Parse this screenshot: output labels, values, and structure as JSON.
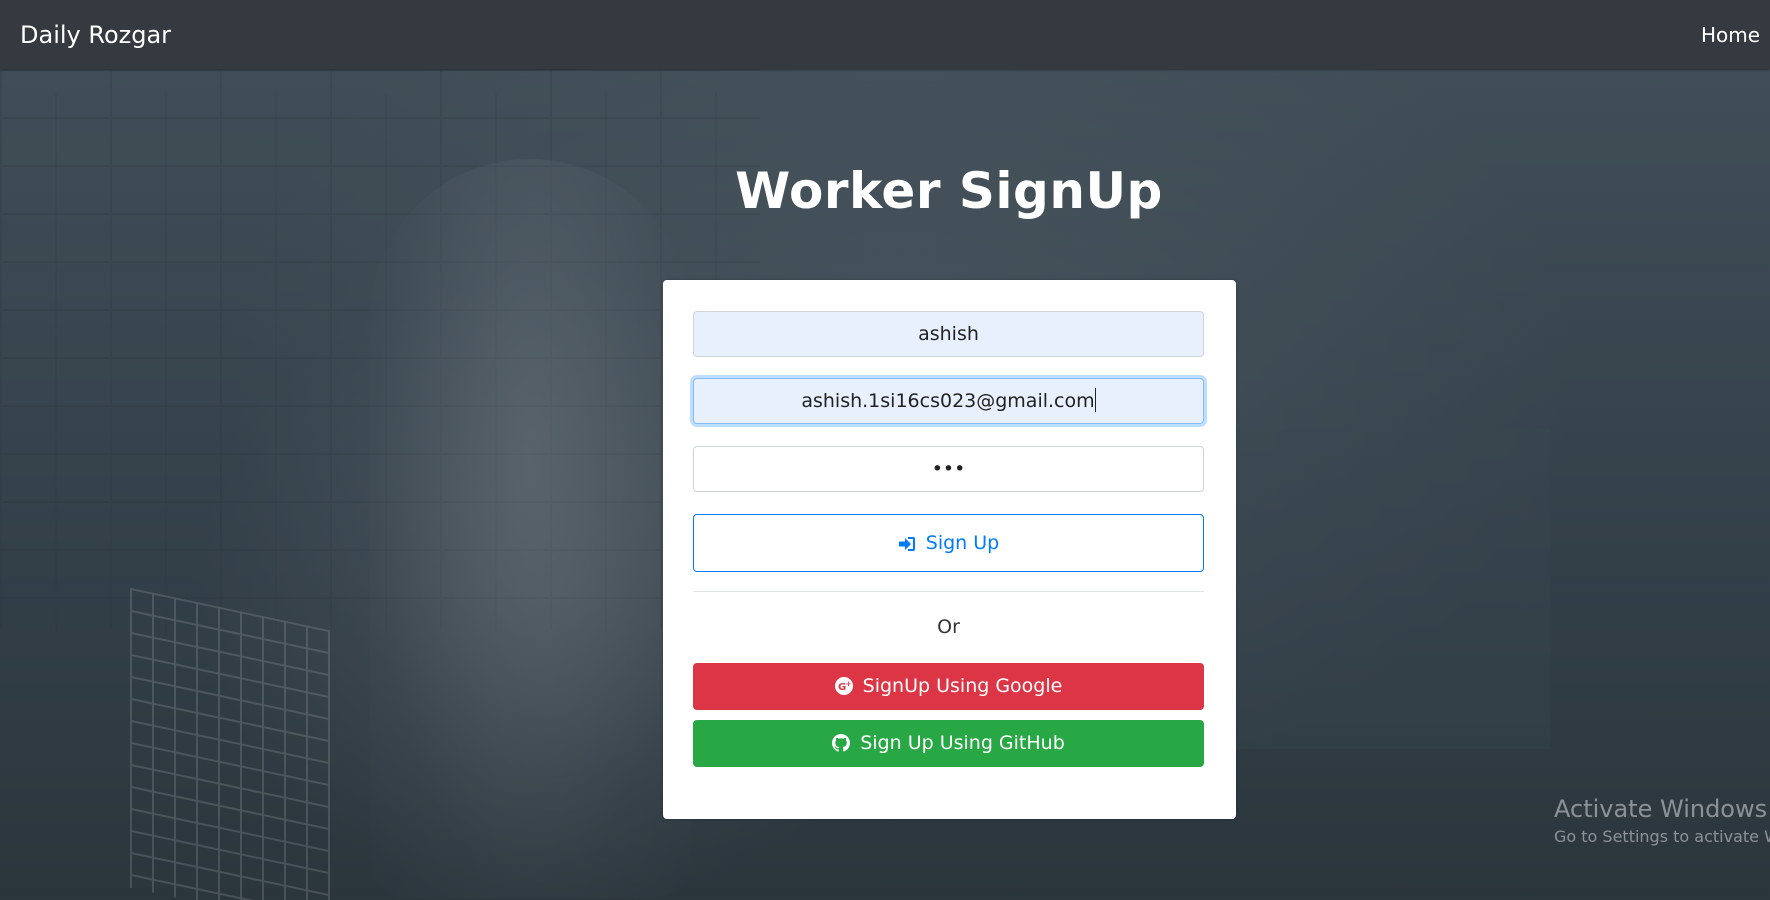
{
  "navbar": {
    "brand": "Daily Rozgar",
    "home_link": "Home"
  },
  "heading": "Worker SignUp",
  "form": {
    "name_value": "ashish",
    "email_value": "ashish.1si16cs023@gmail.com",
    "password_mask": "•••",
    "signup_label": "Sign Up",
    "or_label": "Or",
    "google_label": "SignUp Using Google",
    "github_label": "Sign Up Using GitHub"
  },
  "watermark": {
    "title": "Activate Windows",
    "subtitle": "Go to Settings to activate Windows."
  },
  "colors": {
    "navbar_bg": "#343a40",
    "primary": "#007bff",
    "google_red": "#dc3545",
    "github_green": "#28a745",
    "autofill_bg": "#e8f0fe"
  },
  "icons": {
    "signup": "sign-in-icon",
    "google": "google-plus-icon",
    "github": "github-icon"
  }
}
